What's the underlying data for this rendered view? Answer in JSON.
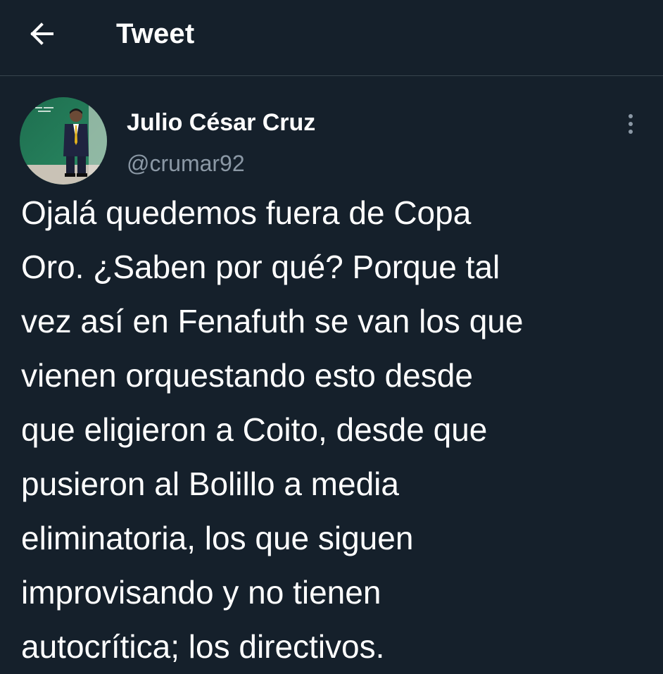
{
  "header": {
    "title": "Tweet",
    "back_icon": "arrow-left-icon"
  },
  "tweet": {
    "author": {
      "display_name": "Julio César Cruz",
      "handle": "@crumar92",
      "avatar": "avatar-photo"
    },
    "more_icon": "more-vertical-icon",
    "text_lines": [
      "Ojalá quedemos fuera de Copa",
      "Oro. ¿Saben por qué? Porque tal",
      "vez así en Fenafuth se van los que",
      "vienen orquestando esto desde",
      "que eligieron a Coito, desde que",
      "pusieron al Bolillo a media",
      "eliminatoria, los que siguen",
      "improvisando y no tienen",
      "autocrítica; los directivos."
    ]
  },
  "colors": {
    "background": "#15202b",
    "text": "#ffffff",
    "secondary_text": "#8b98a5",
    "divider": "#38444d"
  }
}
